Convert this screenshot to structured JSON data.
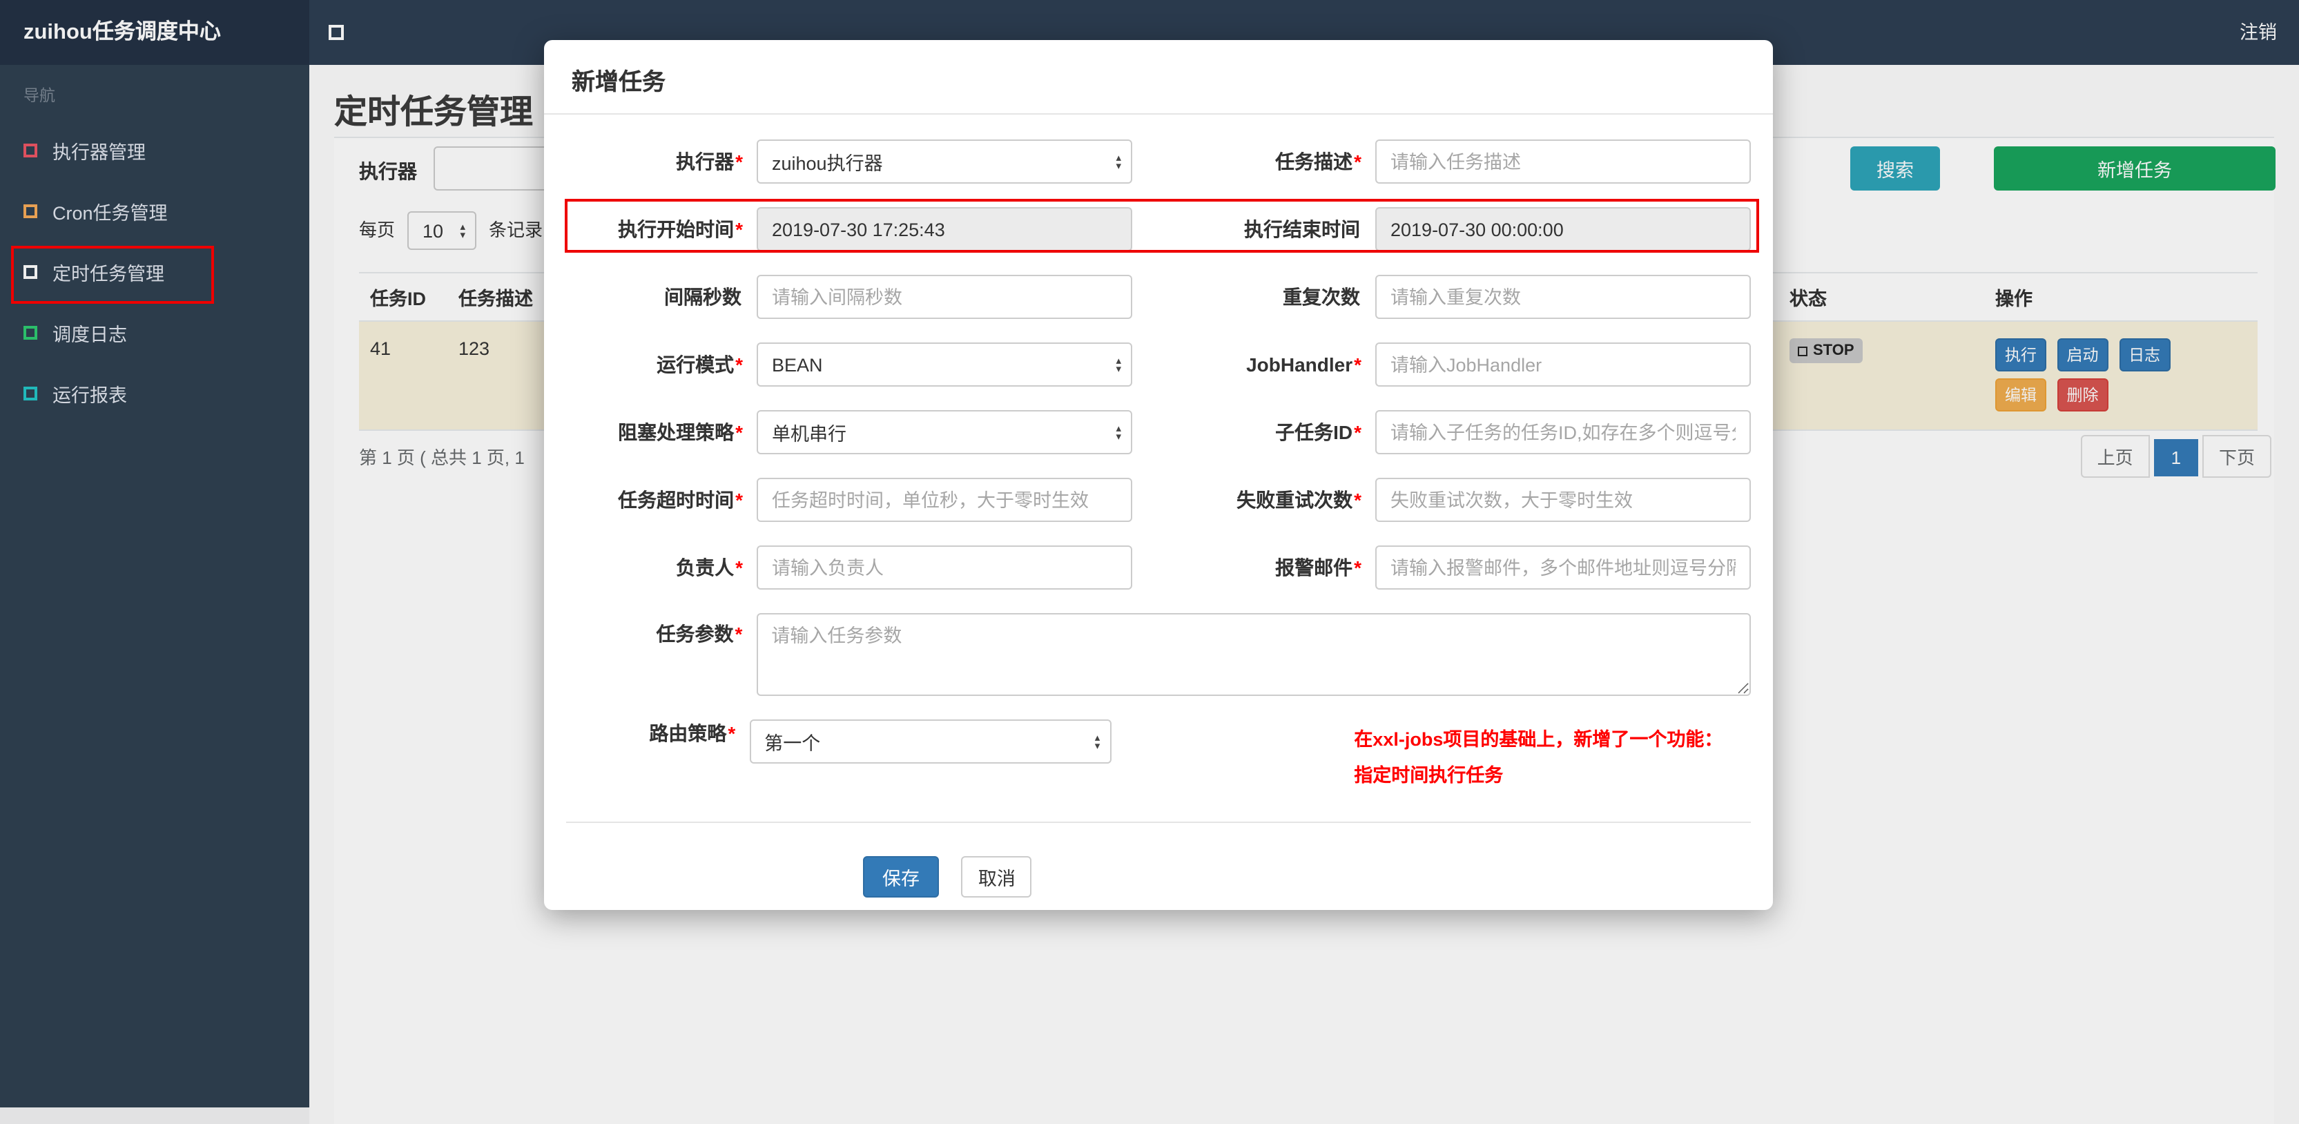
{
  "navbar": {
    "brand": "zuihou任务调度中心",
    "logout": "注销"
  },
  "sidebar": {
    "nav_label": "导航",
    "items": [
      {
        "label": "执行器管理",
        "icon_color": "#ed5565"
      },
      {
        "label": "Cron任务管理",
        "icon_color": "#f8ac59"
      },
      {
        "label": "定时任务管理",
        "icon_color": "#ffffff"
      },
      {
        "label": "调度日志",
        "icon_color": "#2ecc71"
      },
      {
        "label": "运行报表",
        "icon_color": "#23c6c8"
      }
    ]
  },
  "page": {
    "title": "定时任务管理",
    "filter": {
      "executor_label": "执行器",
      "search_button": "搜索",
      "add_task_button": "新增任务"
    },
    "per_page": {
      "prefix": "每页",
      "value": "10",
      "suffix": "条记录"
    },
    "table": {
      "headers": {
        "task_id": "任务ID",
        "task_desc": "任务描述",
        "status": "状态",
        "actions": "操作"
      },
      "row": {
        "task_id": "41",
        "task_desc": "123",
        "status": "STOP",
        "actions": {
          "execute": "执行",
          "start": "启动",
          "log": "日志",
          "edit": "编辑",
          "delete": "删除"
        }
      }
    },
    "pagination": {
      "info": "第 1 页 ( 总共 1 页, 1",
      "prev": "上页",
      "current": "1",
      "next": "下页"
    }
  },
  "modal": {
    "title": "新增任务",
    "fields": {
      "executor": {
        "label": "执行器",
        "required": "*",
        "value": "zuihou执行器"
      },
      "job_desc": {
        "label": "任务描述",
        "required": "*",
        "placeholder": "请输入任务描述"
      },
      "start_time": {
        "label": "执行开始时间",
        "required": "*",
        "value": "2019-07-30 17:25:43"
      },
      "end_time": {
        "label": "执行结束时间",
        "required": "",
        "value": "2019-07-30 00:00:00"
      },
      "interval_seconds": {
        "label": "间隔秒数",
        "required": "",
        "placeholder": "请输入间隔秒数"
      },
      "repeat_count": {
        "label": "重复次数",
        "required": "",
        "placeholder": "请输入重复次数"
      },
      "run_mode": {
        "label": "运行模式",
        "required": "*",
        "value": "BEAN"
      },
      "job_handler": {
        "label": "JobHandler",
        "required": "*",
        "placeholder": "请输入JobHandler"
      },
      "block_strategy": {
        "label": "阻塞处理策略",
        "required": "*",
        "value": "单机串行"
      },
      "child_job_id": {
        "label": "子任务ID",
        "required": "*",
        "placeholder": "请输入子任务的任务ID,如存在多个则逗号分隔"
      },
      "timeout": {
        "label": "任务超时时间",
        "required": "*",
        "placeholder": "任务超时时间，单位秒，大于零时生效"
      },
      "fail_retry_count": {
        "label": "失败重试次数",
        "required": "*",
        "placeholder": "失败重试次数，大于零时生效"
      },
      "author": {
        "label": "负责人",
        "required": "*",
        "placeholder": "请输入负责人"
      },
      "alarm_email": {
        "label": "报警邮件",
        "required": "*",
        "placeholder": "请输入报警邮件，多个邮件地址则逗号分隔"
      },
      "job_param": {
        "label": "任务参数",
        "required": "*",
        "placeholder": "请输入任务参数"
      },
      "route_strategy": {
        "label": "路由策略",
        "required": "*",
        "value": "第一个"
      }
    },
    "note_line1": "在xxl-jobs项目的基础上，新增了一个功能：",
    "note_line2": "指定时间执行任务",
    "save_button": "保存",
    "cancel_button": "取消"
  },
  "colors": {
    "search_button": "#2da4b8",
    "add_task_button": "#18a45c",
    "primary_button": "#337ab7",
    "warning_button": "#f0ad4e",
    "danger_button": "#d9534f",
    "annotation_box": "#ee0000",
    "note_text": "#ff0000"
  }
}
